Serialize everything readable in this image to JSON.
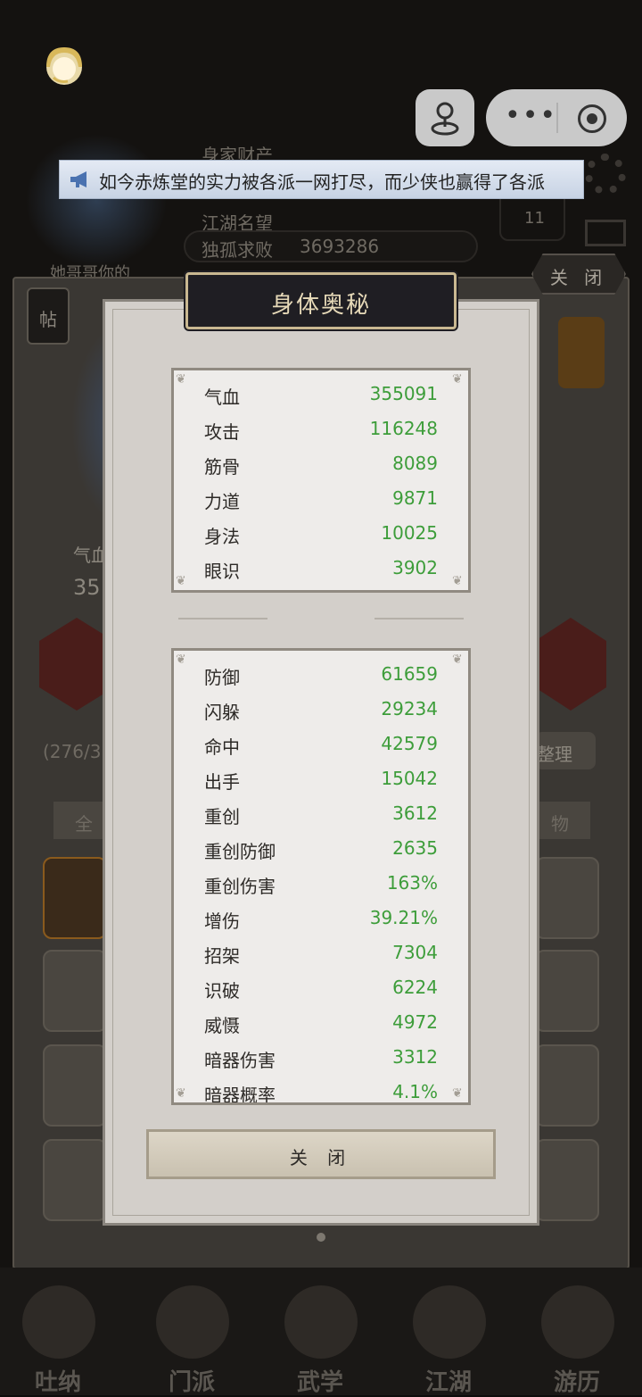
{
  "background": {
    "assets_label": "身家财产",
    "fame_label": "江湖名望",
    "rank_title": "独孤求败",
    "fame_value": "3693286",
    "level_badge": "11",
    "status_caption": "她哥哥你的",
    "post_label": "帖",
    "hp_partial": "气血",
    "hp_value_partial": "35",
    "bag_count": "(276/3",
    "sort_label": "整理",
    "filter_all": "全",
    "filter_item": "物"
  },
  "notice": {
    "text": "如今赤炼堂的实力被各派一网打尽，而少侠也赢得了各派"
  },
  "top_close": "关 闭",
  "modal": {
    "title": "身体奥秘",
    "close_button": "关 闭"
  },
  "primary_stats": [
    {
      "label": "气血",
      "value": "355091"
    },
    {
      "label": "攻击",
      "value": "116248"
    },
    {
      "label": "筋骨",
      "value": "8089"
    },
    {
      "label": "力道",
      "value": "9871"
    },
    {
      "label": "身法",
      "value": "10025"
    },
    {
      "label": "眼识",
      "value": "3902"
    }
  ],
  "secondary_stats": [
    {
      "label": "防御",
      "value": "61659"
    },
    {
      "label": "闪躲",
      "value": "29234"
    },
    {
      "label": "命中",
      "value": "42579"
    },
    {
      "label": "出手",
      "value": "15042"
    },
    {
      "label": "重创",
      "value": "3612"
    },
    {
      "label": "重创防御",
      "value": "2635"
    },
    {
      "label": "重创伤害",
      "value": "163%"
    },
    {
      "label": "增伤",
      "value": "39.21%"
    },
    {
      "label": "招架",
      "value": "7304"
    },
    {
      "label": "识破",
      "value": "6224"
    },
    {
      "label": "威慑",
      "value": "4972"
    },
    {
      "label": "暗器伤害",
      "value": "3312"
    },
    {
      "label": "暗器概率",
      "value": "4.1%"
    }
  ],
  "nav": [
    {
      "label": "吐纳"
    },
    {
      "label": "门派"
    },
    {
      "label": "武学"
    },
    {
      "label": "江湖"
    },
    {
      "label": "游历"
    }
  ],
  "colors": {
    "stat_value": "#3d9d3a",
    "title_text": "#e6d9b8",
    "modal_bg": "#d3cfca"
  }
}
